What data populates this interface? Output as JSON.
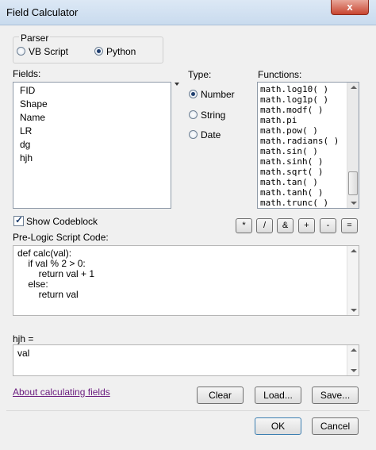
{
  "window": {
    "title": "Field Calculator",
    "close_glyph": "x"
  },
  "parser": {
    "label": "Parser",
    "options": [
      {
        "label": "VB Script",
        "selected": false
      },
      {
        "label": "Python",
        "selected": true
      }
    ]
  },
  "fields": {
    "label": "Fields:",
    "items": [
      "FID",
      "Shape",
      "Name",
      "LR",
      "dg",
      "hjh"
    ]
  },
  "type": {
    "label": "Type:",
    "options": [
      {
        "label": "Number",
        "selected": true
      },
      {
        "label": "String",
        "selected": false
      },
      {
        "label": "Date",
        "selected": false
      }
    ]
  },
  "functions": {
    "label": "Functions:",
    "items": [
      "math.log10( )",
      "math.log1p( )",
      "math.modf( )",
      "math.pi",
      "math.pow( )",
      "math.radians( )",
      "math.sin( )",
      "math.sinh( )",
      "math.sqrt( )",
      "math.tan( )",
      "math.tanh( )",
      "math.trunc( )"
    ]
  },
  "codeblock": {
    "label": "Show Codeblock",
    "checked": true
  },
  "operators": [
    "*",
    "/",
    "&",
    "+",
    "-",
    "="
  ],
  "pre_logic": {
    "label": "Pre-Logic Script Code:",
    "lines": [
      "def calc(val):",
      "    if val % 2 > 0:",
      "        return val + 1",
      "    else:",
      "        return val"
    ]
  },
  "expression": {
    "label": "hjh =",
    "value": "val"
  },
  "link": {
    "label": "About calculating fields"
  },
  "buttons": {
    "clear": "Clear",
    "load": "Load...",
    "save": "Save...",
    "ok": "OK",
    "cancel": "Cancel"
  },
  "icons": {
    "close": "close-icon",
    "sort": "sort-arrow-icon",
    "scroll_up": "scroll-up-arrow-icon",
    "scroll_down": "scroll-down-arrow-icon"
  }
}
